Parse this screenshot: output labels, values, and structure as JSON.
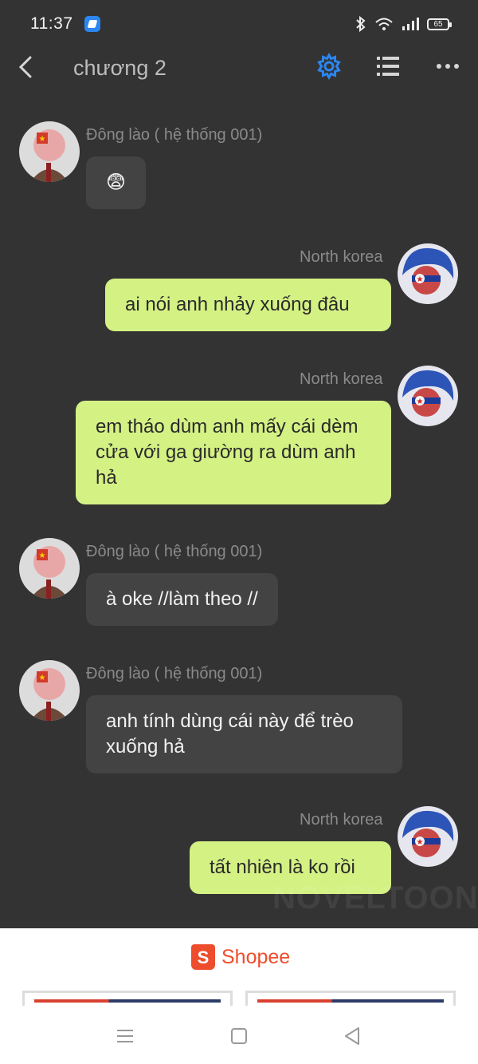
{
  "status": {
    "time": "11:37",
    "battery": "65"
  },
  "header": {
    "title": "chương 2"
  },
  "colors": {
    "background": "#333333",
    "accent": "#2b86f0",
    "bubble_other": "#434343",
    "bubble_self": "#d4f184",
    "shopee": "#ee4d2d"
  },
  "messages": [
    {
      "sender": "Đông lào ( hệ thống 001)",
      "text": "😨",
      "side": "left"
    },
    {
      "sender": "North korea",
      "text": "ai nói anh nhảy xuống đâu",
      "side": "right"
    },
    {
      "sender": "North korea",
      "text": "em tháo dùm anh mấy cái dèm cửa với ga giường ra dùm anh hả",
      "side": "right"
    },
    {
      "sender": "Đông lào ( hệ thống 001)",
      "text": "à oke //làm theo //",
      "side": "left"
    },
    {
      "sender": "Đông lào ( hệ thống 001)",
      "text": "anh tính dùng cái này để trèo xuống hả",
      "side": "left"
    },
    {
      "sender": "North korea",
      "text": "tất nhiên là ko rồi",
      "side": "right"
    }
  ],
  "watermark": "NOVELTOON",
  "ad": {
    "brand": "Shopee",
    "logo_letter": "S"
  },
  "nav": {
    "menu_icon": "menu-icon",
    "home_icon": "home-square-icon",
    "back_icon": "back-triangle-icon"
  }
}
